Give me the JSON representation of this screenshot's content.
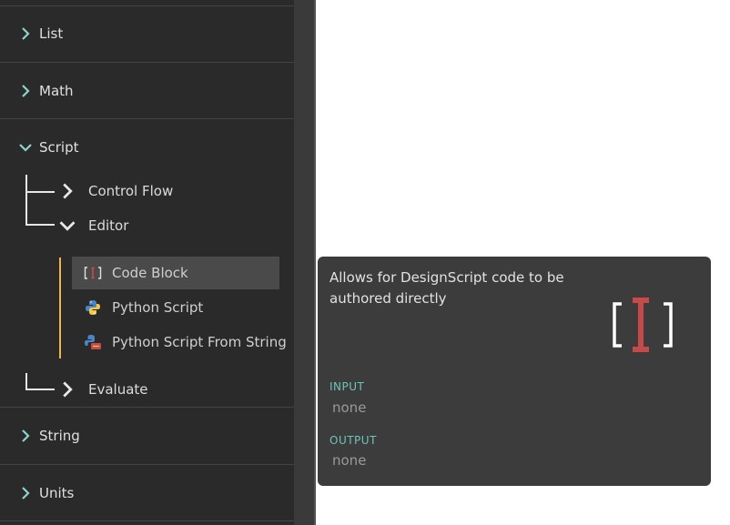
{
  "library": {
    "categories": [
      {
        "label": "List",
        "expanded": false
      },
      {
        "label": "Math",
        "expanded": false
      },
      {
        "label": "Script",
        "expanded": true
      },
      {
        "label": "String",
        "expanded": false
      },
      {
        "label": "Units",
        "expanded": false
      }
    ],
    "script_children": [
      {
        "label": "Control Flow",
        "expanded": false
      },
      {
        "label": "Editor",
        "expanded": true
      },
      {
        "label": "Evaluate",
        "expanded": false
      }
    ],
    "editor_nodes": [
      {
        "label": "Code Block",
        "icon": "code-block-icon",
        "selected": true
      },
      {
        "label": "Python Script",
        "icon": "python-icon",
        "selected": false
      },
      {
        "label": "Python Script From String",
        "icon": "python-string-icon",
        "selected": false
      }
    ]
  },
  "tooltip": {
    "description": "Allows for DesignScript code to be authored directly",
    "icon": "code-block-large-icon",
    "input_heading": "INPUT",
    "input_value": "none",
    "output_heading": "OUTPUT",
    "output_value": "none"
  },
  "colors": {
    "panel_bg": "#2a2a2a",
    "accent_teal": "#8fd3cf",
    "tree_accent": "#f0b64a",
    "code_block_red": "#c64a4a",
    "tooltip_bg": "#3c3c3c"
  }
}
